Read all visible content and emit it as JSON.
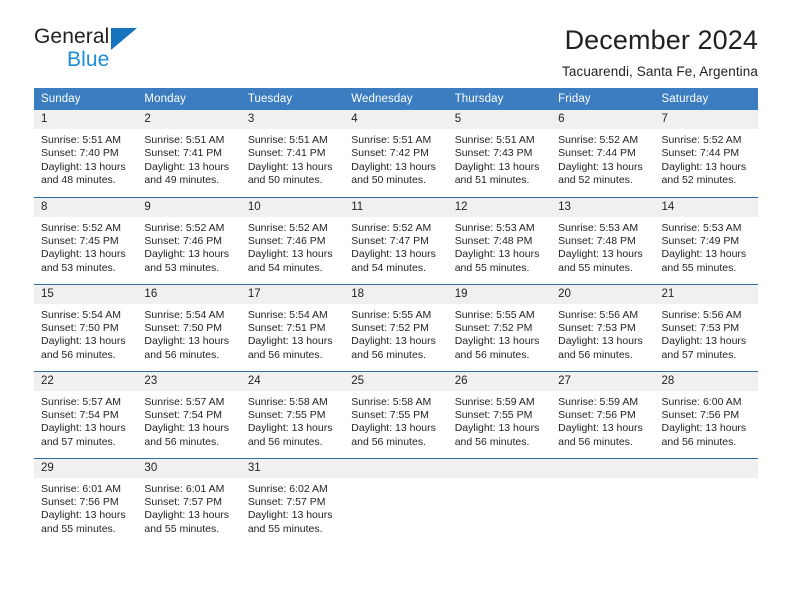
{
  "brand": {
    "name_dark": "General",
    "name_blue": "Blue",
    "accent_blue": "#1574bb",
    "light_blue": "#1a8fd6"
  },
  "header": {
    "title": "December 2024",
    "subtitle": "Tacuarendi, Santa Fe, Argentina"
  },
  "calendar": {
    "header_bg": "#3b7dc0",
    "daynum_bg": "#f0f0f0",
    "weekdays": [
      "Sunday",
      "Monday",
      "Tuesday",
      "Wednesday",
      "Thursday",
      "Friday",
      "Saturday"
    ],
    "weeks": [
      [
        {
          "day": "1",
          "sunrise": "Sunrise: 5:51 AM",
          "sunset": "Sunset: 7:40 PM",
          "daylight1": "Daylight: 13 hours",
          "daylight2": "and 48 minutes."
        },
        {
          "day": "2",
          "sunrise": "Sunrise: 5:51 AM",
          "sunset": "Sunset: 7:41 PM",
          "daylight1": "Daylight: 13 hours",
          "daylight2": "and 49 minutes."
        },
        {
          "day": "3",
          "sunrise": "Sunrise: 5:51 AM",
          "sunset": "Sunset: 7:41 PM",
          "daylight1": "Daylight: 13 hours",
          "daylight2": "and 50 minutes."
        },
        {
          "day": "4",
          "sunrise": "Sunrise: 5:51 AM",
          "sunset": "Sunset: 7:42 PM",
          "daylight1": "Daylight: 13 hours",
          "daylight2": "and 50 minutes."
        },
        {
          "day": "5",
          "sunrise": "Sunrise: 5:51 AM",
          "sunset": "Sunset: 7:43 PM",
          "daylight1": "Daylight: 13 hours",
          "daylight2": "and 51 minutes."
        },
        {
          "day": "6",
          "sunrise": "Sunrise: 5:52 AM",
          "sunset": "Sunset: 7:44 PM",
          "daylight1": "Daylight: 13 hours",
          "daylight2": "and 52 minutes."
        },
        {
          "day": "7",
          "sunrise": "Sunrise: 5:52 AM",
          "sunset": "Sunset: 7:44 PM",
          "daylight1": "Daylight: 13 hours",
          "daylight2": "and 52 minutes."
        }
      ],
      [
        {
          "day": "8",
          "sunrise": "Sunrise: 5:52 AM",
          "sunset": "Sunset: 7:45 PM",
          "daylight1": "Daylight: 13 hours",
          "daylight2": "and 53 minutes."
        },
        {
          "day": "9",
          "sunrise": "Sunrise: 5:52 AM",
          "sunset": "Sunset: 7:46 PM",
          "daylight1": "Daylight: 13 hours",
          "daylight2": "and 53 minutes."
        },
        {
          "day": "10",
          "sunrise": "Sunrise: 5:52 AM",
          "sunset": "Sunset: 7:46 PM",
          "daylight1": "Daylight: 13 hours",
          "daylight2": "and 54 minutes."
        },
        {
          "day": "11",
          "sunrise": "Sunrise: 5:52 AM",
          "sunset": "Sunset: 7:47 PM",
          "daylight1": "Daylight: 13 hours",
          "daylight2": "and 54 minutes."
        },
        {
          "day": "12",
          "sunrise": "Sunrise: 5:53 AM",
          "sunset": "Sunset: 7:48 PM",
          "daylight1": "Daylight: 13 hours",
          "daylight2": "and 55 minutes."
        },
        {
          "day": "13",
          "sunrise": "Sunrise: 5:53 AM",
          "sunset": "Sunset: 7:48 PM",
          "daylight1": "Daylight: 13 hours",
          "daylight2": "and 55 minutes."
        },
        {
          "day": "14",
          "sunrise": "Sunrise: 5:53 AM",
          "sunset": "Sunset: 7:49 PM",
          "daylight1": "Daylight: 13 hours",
          "daylight2": "and 55 minutes."
        }
      ],
      [
        {
          "day": "15",
          "sunrise": "Sunrise: 5:54 AM",
          "sunset": "Sunset: 7:50 PM",
          "daylight1": "Daylight: 13 hours",
          "daylight2": "and 56 minutes."
        },
        {
          "day": "16",
          "sunrise": "Sunrise: 5:54 AM",
          "sunset": "Sunset: 7:50 PM",
          "daylight1": "Daylight: 13 hours",
          "daylight2": "and 56 minutes."
        },
        {
          "day": "17",
          "sunrise": "Sunrise: 5:54 AM",
          "sunset": "Sunset: 7:51 PM",
          "daylight1": "Daylight: 13 hours",
          "daylight2": "and 56 minutes."
        },
        {
          "day": "18",
          "sunrise": "Sunrise: 5:55 AM",
          "sunset": "Sunset: 7:52 PM",
          "daylight1": "Daylight: 13 hours",
          "daylight2": "and 56 minutes."
        },
        {
          "day": "19",
          "sunrise": "Sunrise: 5:55 AM",
          "sunset": "Sunset: 7:52 PM",
          "daylight1": "Daylight: 13 hours",
          "daylight2": "and 56 minutes."
        },
        {
          "day": "20",
          "sunrise": "Sunrise: 5:56 AM",
          "sunset": "Sunset: 7:53 PM",
          "daylight1": "Daylight: 13 hours",
          "daylight2": "and 56 minutes."
        },
        {
          "day": "21",
          "sunrise": "Sunrise: 5:56 AM",
          "sunset": "Sunset: 7:53 PM",
          "daylight1": "Daylight: 13 hours",
          "daylight2": "and 57 minutes."
        }
      ],
      [
        {
          "day": "22",
          "sunrise": "Sunrise: 5:57 AM",
          "sunset": "Sunset: 7:54 PM",
          "daylight1": "Daylight: 13 hours",
          "daylight2": "and 57 minutes."
        },
        {
          "day": "23",
          "sunrise": "Sunrise: 5:57 AM",
          "sunset": "Sunset: 7:54 PM",
          "daylight1": "Daylight: 13 hours",
          "daylight2": "and 56 minutes."
        },
        {
          "day": "24",
          "sunrise": "Sunrise: 5:58 AM",
          "sunset": "Sunset: 7:55 PM",
          "daylight1": "Daylight: 13 hours",
          "daylight2": "and 56 minutes."
        },
        {
          "day": "25",
          "sunrise": "Sunrise: 5:58 AM",
          "sunset": "Sunset: 7:55 PM",
          "daylight1": "Daylight: 13 hours",
          "daylight2": "and 56 minutes."
        },
        {
          "day": "26",
          "sunrise": "Sunrise: 5:59 AM",
          "sunset": "Sunset: 7:55 PM",
          "daylight1": "Daylight: 13 hours",
          "daylight2": "and 56 minutes."
        },
        {
          "day": "27",
          "sunrise": "Sunrise: 5:59 AM",
          "sunset": "Sunset: 7:56 PM",
          "daylight1": "Daylight: 13 hours",
          "daylight2": "and 56 minutes."
        },
        {
          "day": "28",
          "sunrise": "Sunrise: 6:00 AM",
          "sunset": "Sunset: 7:56 PM",
          "daylight1": "Daylight: 13 hours",
          "daylight2": "and 56 minutes."
        }
      ],
      [
        {
          "day": "29",
          "sunrise": "Sunrise: 6:01 AM",
          "sunset": "Sunset: 7:56 PM",
          "daylight1": "Daylight: 13 hours",
          "daylight2": "and 55 minutes."
        },
        {
          "day": "30",
          "sunrise": "Sunrise: 6:01 AM",
          "sunset": "Sunset: 7:57 PM",
          "daylight1": "Daylight: 13 hours",
          "daylight2": "and 55 minutes."
        },
        {
          "day": "31",
          "sunrise": "Sunrise: 6:02 AM",
          "sunset": "Sunset: 7:57 PM",
          "daylight1": "Daylight: 13 hours",
          "daylight2": "and 55 minutes."
        },
        {
          "day": "",
          "sunrise": "",
          "sunset": "",
          "daylight1": "",
          "daylight2": ""
        },
        {
          "day": "",
          "sunrise": "",
          "sunset": "",
          "daylight1": "",
          "daylight2": ""
        },
        {
          "day": "",
          "sunrise": "",
          "sunset": "",
          "daylight1": "",
          "daylight2": ""
        },
        {
          "day": "",
          "sunrise": "",
          "sunset": "",
          "daylight1": "",
          "daylight2": ""
        }
      ]
    ]
  }
}
